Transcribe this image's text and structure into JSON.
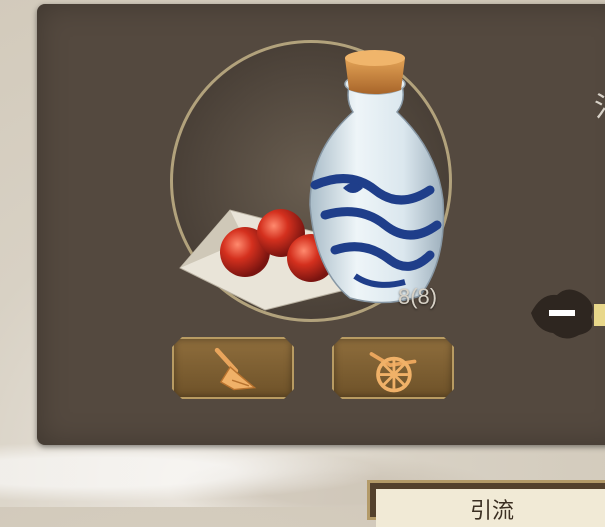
{
  "item": {
    "name_icon": "medicine-bottle-and-pills-icon",
    "count_text": "8(8)"
  },
  "buttons": {
    "clean_icon": "broom-icon",
    "cart_icon": "cart-wheel-icon"
  },
  "side": {
    "char": "氵",
    "minus_icon": "minus-icon"
  },
  "bottom": {
    "label": "引流"
  }
}
